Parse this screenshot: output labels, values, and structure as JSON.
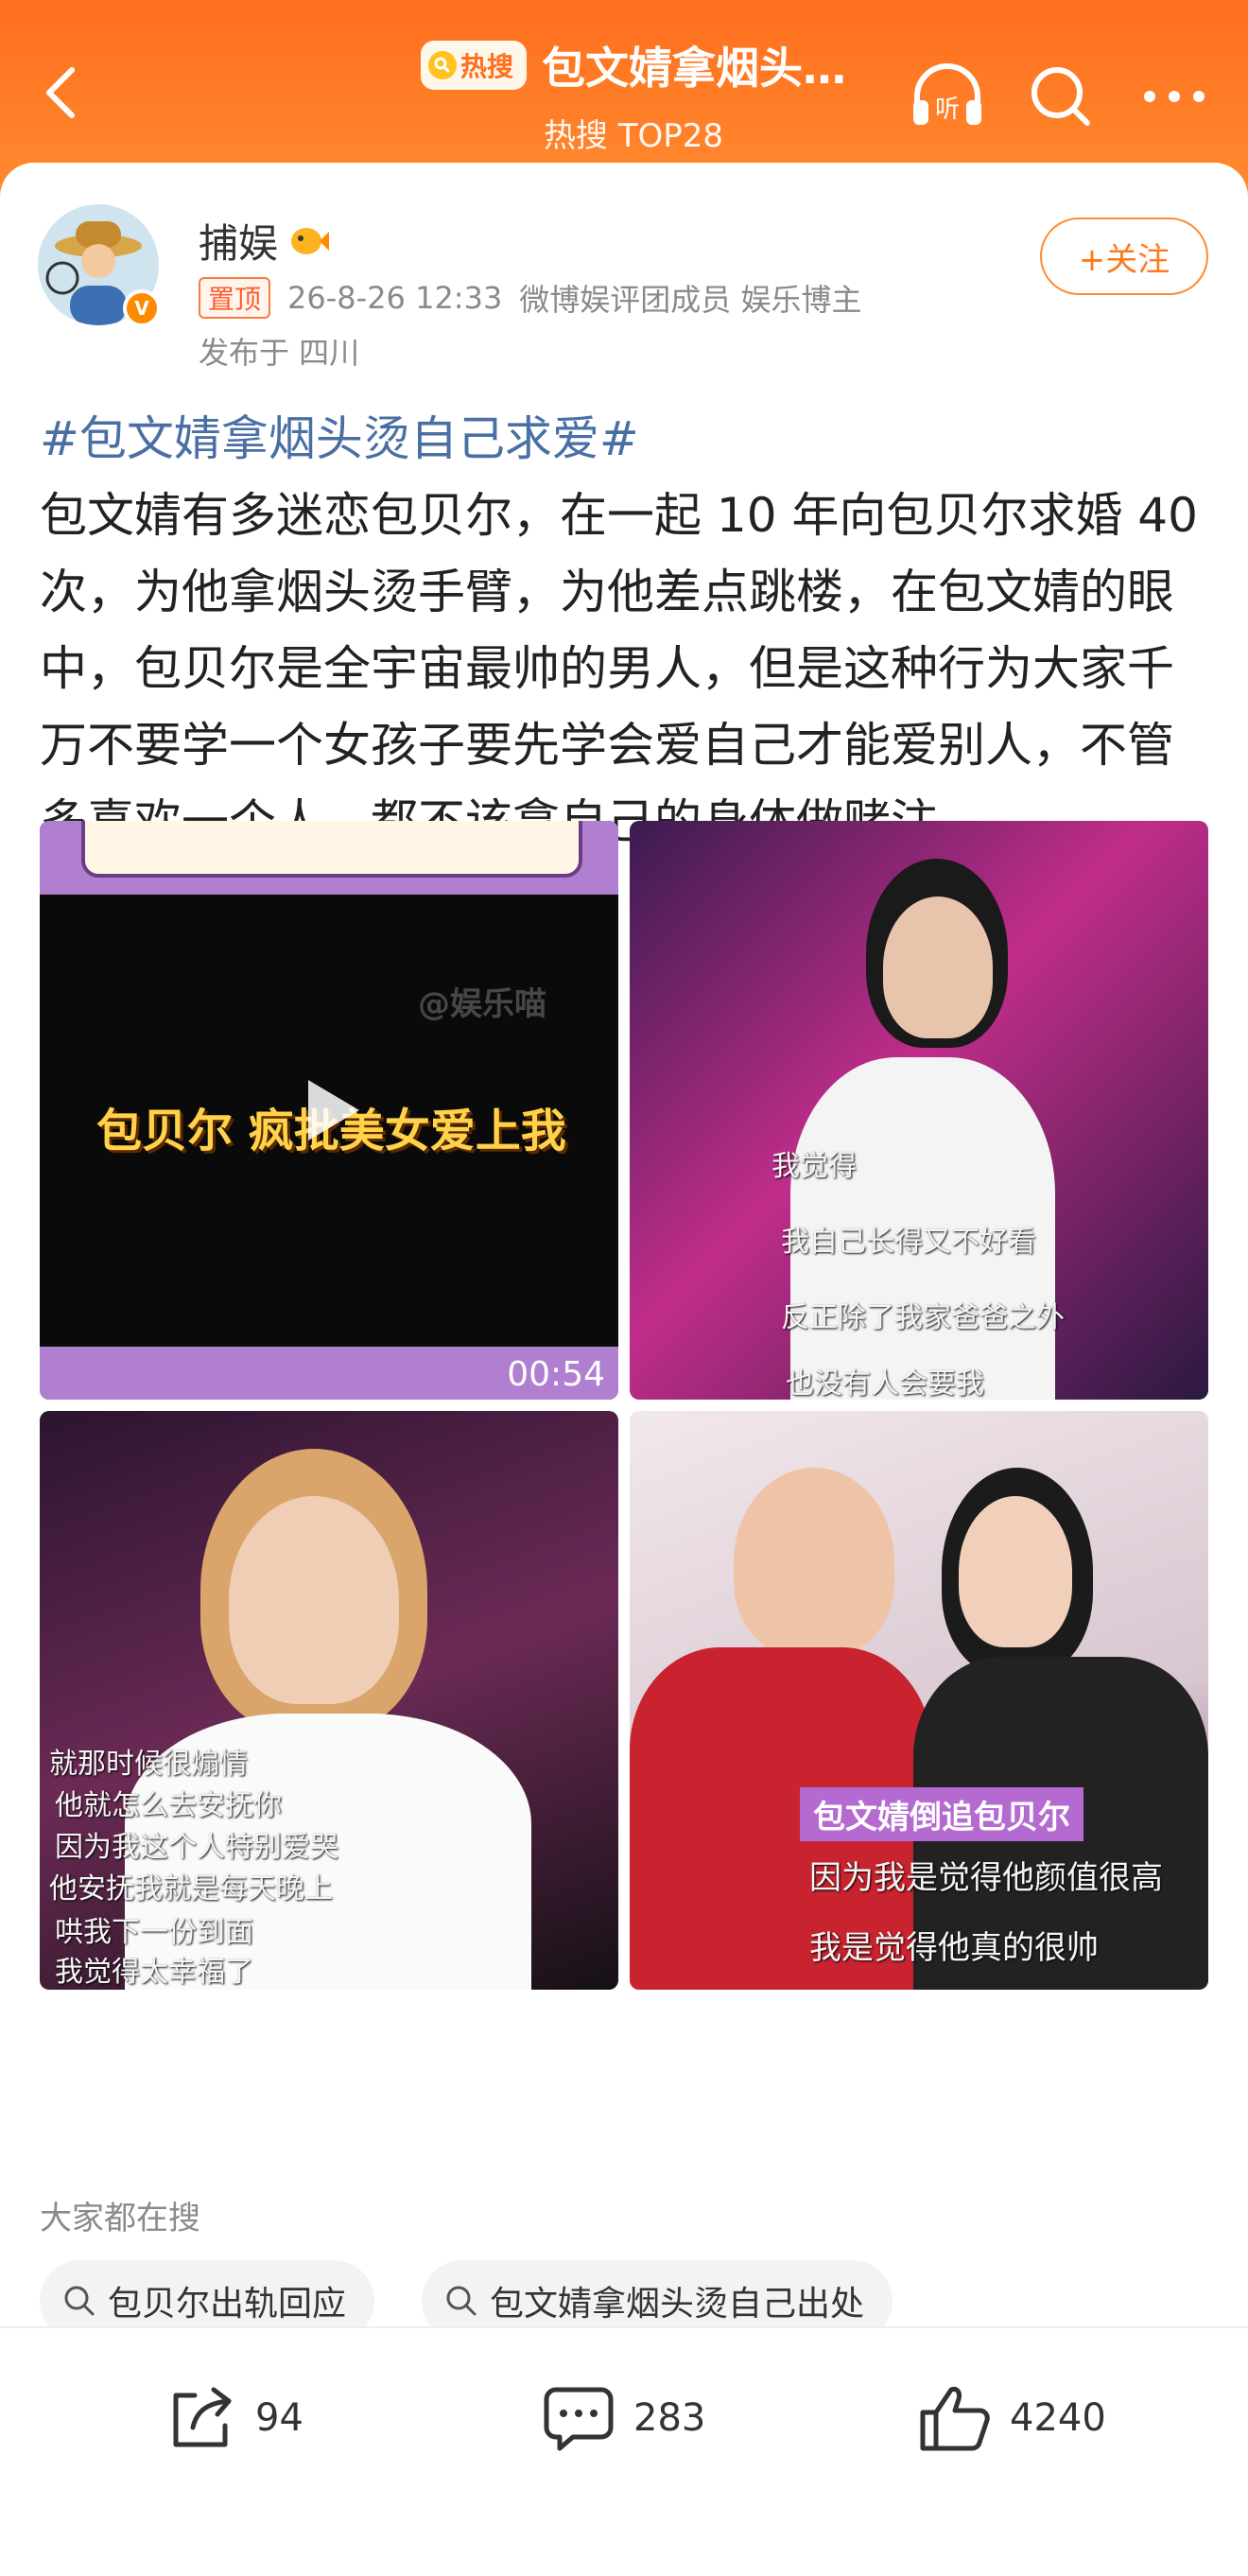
{
  "header": {
    "badge": "热搜",
    "title": "包文婧拿烟头…",
    "subtitle": "热搜 TOP28",
    "listen_label": "听"
  },
  "post": {
    "username": "捕娱",
    "pinned_label": "置顶",
    "timestamp": "26-8-26 12:33",
    "roles": "微博娱评团成员 娱乐博主",
    "location": "发布于 四川",
    "follow_label": "+关注",
    "hashtag": "#包文婧拿烟头烫自己求爱#",
    "body": "包文婧有多迷恋包贝尔，在一起 10 年向包贝尔求婚 40 次，为他拿烟头烫手臂，为他差点跳楼，在包文婧的眼中，包贝尔是全宇宙最帅的男人，但是这种行为大家千万不要学一个女孩子要先学会爱自己才能爱别人，不管多喜欢一个人，都不该拿自己的身体做赌注"
  },
  "media": {
    "video_caption": "包贝尔 疯批美女爱上我",
    "video_watermark": "@娱乐喵",
    "video_duration": "00:54",
    "tile2_subs": [
      "我觉得",
      "我自己长得又不好看",
      "反正除了我家爸爸之外",
      "也没有人会要我"
    ],
    "tile3_subs": [
      "就那时候很煽情",
      "他就怎么去安抚你",
      "因为我这个人特别爱哭",
      "他安抚我就是每天晚上",
      "哄我下一份到面",
      "我觉得太幸福了"
    ],
    "tile4_label": "包文婧倒追包贝尔",
    "tile4_subs": [
      "因为我是觉得他颜值很高",
      "我是觉得他真的很帅"
    ]
  },
  "search": {
    "title": "大家都在搜",
    "chips": [
      "包贝尔出轨回应",
      "包文婧拿烟头烫自己出处"
    ]
  },
  "footer": {
    "reposts": "94",
    "comments": "283",
    "likes": "4240"
  },
  "colors": {
    "header": "#ff7a25",
    "hashtag": "#4a6fa5",
    "follow": "#ff7a1f"
  }
}
